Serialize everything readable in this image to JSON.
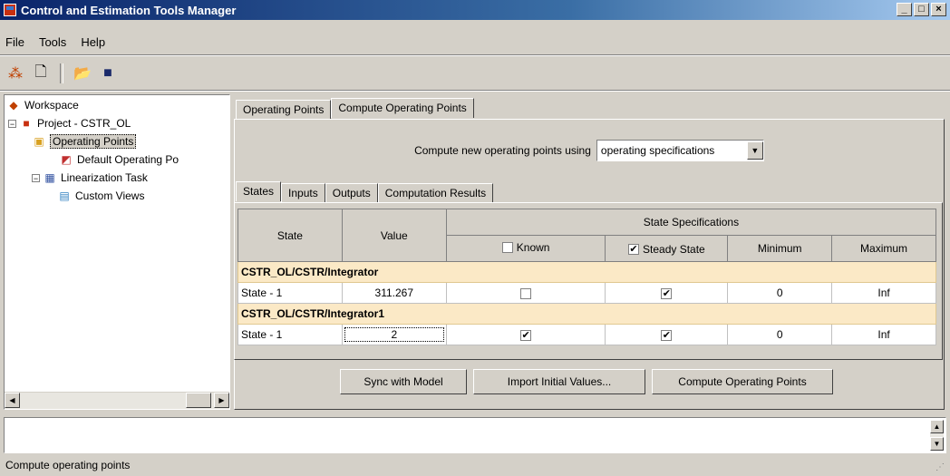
{
  "window": {
    "title": "Control and Estimation Tools Manager"
  },
  "menu": [
    "File",
    "Tools",
    "Help"
  ],
  "tree": {
    "workspace": "Workspace",
    "project": "Project - CSTR_OL",
    "operating_points": "Operating Points",
    "default_op": "Default Operating Po",
    "linearization": "Linearization Task",
    "custom_views": "Custom Views"
  },
  "tabs_top": [
    "Operating Points",
    "Compute Operating Points"
  ],
  "compute": {
    "label": "Compute new operating points using",
    "selected": "operating specifications"
  },
  "tabs_inner": [
    "States",
    "Inputs",
    "Outputs",
    "Computation Results"
  ],
  "table": {
    "col_state": "State",
    "col_value": "Value",
    "spec_header": "State Specifications",
    "col_known": "Known",
    "col_steady": "Steady State",
    "col_min": "Minimum",
    "col_max": "Maximum",
    "groups": [
      {
        "name": "CSTR_OL/CSTR/Integrator",
        "row": {
          "state": "State - 1",
          "value": "311.267",
          "known": false,
          "steady": true,
          "min": "0",
          "max": "Inf"
        }
      },
      {
        "name": "CSTR_OL/CSTR/Integrator1",
        "row": {
          "state": "State - 1",
          "value": "2",
          "known": true,
          "steady": true,
          "min": "0",
          "max": "Inf"
        }
      }
    ]
  },
  "buttons": {
    "sync": "Sync with Model",
    "import": "Import Initial Values...",
    "compute": "Compute Operating Points"
  },
  "status": "Compute operating points",
  "check_mark": "✔"
}
